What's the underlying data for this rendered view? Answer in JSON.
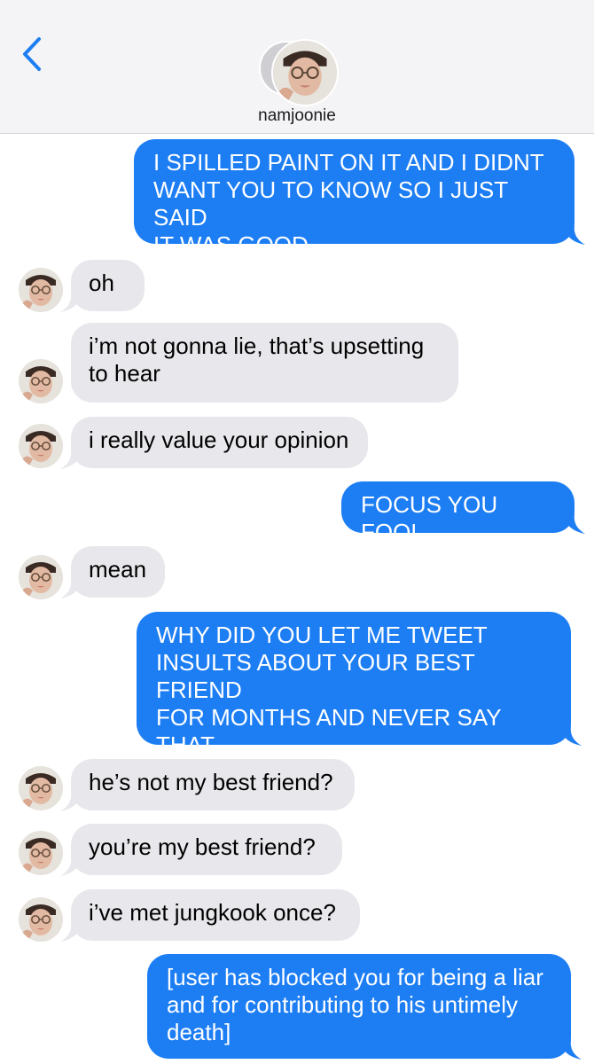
{
  "header": {
    "back_icon": "chevron-left-icon",
    "contact_name": "namjoonie"
  },
  "colors": {
    "outgoing": "#1d7ef4",
    "incoming": "#e8e8ec",
    "accent": "#1d7ef4"
  },
  "messages": [
    {
      "from": "me",
      "text": "I SPILLED PAINT ON IT AND I DIDNT\nWANT YOU TO KNOW SO I JUST SAID\nIT WAS GOOD"
    },
    {
      "from": "contact",
      "text": "oh"
    },
    {
      "from": "contact",
      "text": "i’m not gonna lie, that’s upsetting\nto hear"
    },
    {
      "from": "contact",
      "text": "i really value your opinion"
    },
    {
      "from": "me",
      "text": "FOCUS YOU FOOL"
    },
    {
      "from": "contact",
      "text": "mean"
    },
    {
      "from": "me",
      "text": "WHY DID YOU LET ME TWEET\nINSULTS ABOUT YOUR BEST FRIEND\nFOR MONTHS AND NEVER SAY THAT\nYOU KNEW HIM"
    },
    {
      "from": "contact",
      "text": "he’s not my best friend?"
    },
    {
      "from": "contact",
      "text": "you’re my best friend?"
    },
    {
      "from": "contact",
      "text": "i’ve met jungkook once?"
    },
    {
      "from": "me",
      "text": "[user has blocked you for being a liar\nand for contributing to his untimely\ndeath]"
    }
  ]
}
